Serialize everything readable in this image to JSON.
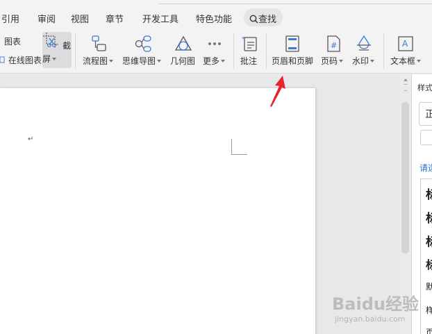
{
  "ribbon": {
    "tabs": [
      {
        "id": "references",
        "label": "引用"
      },
      {
        "id": "review",
        "label": "审阅"
      },
      {
        "id": "view",
        "label": "视图"
      },
      {
        "id": "chapter",
        "label": "章节"
      },
      {
        "id": "developer",
        "label": "开发工具"
      },
      {
        "id": "features",
        "label": "特色功能"
      }
    ],
    "search_label": "查找"
  },
  "toolbar": {
    "chart_label": "图表",
    "online_chart_label": "在线图表",
    "screenshot_label": "截屏",
    "flowchart_label": "流程图",
    "mindmap_label": "思维导图",
    "geometry_label": "几何图",
    "more_label": "更多",
    "comment_label": "批注",
    "header_footer_label": "页眉和页脚",
    "page_number_label": "页码",
    "watermark_label": "水印",
    "textbox_label": "文本框"
  },
  "document": {
    "paragraph_mark": "↵"
  },
  "styles_pane": {
    "title": "样式",
    "current_style": "正",
    "link_text": "请选",
    "items": [
      "标",
      "标",
      "标",
      "标",
      "默",
      "样",
      "页"
    ]
  },
  "colors": {
    "annotation_arrow": "#e8242c",
    "link": "#2b6ed6"
  },
  "watermark": {
    "logo": "Baidu经验",
    "url": "jingyan.baidu.com"
  }
}
